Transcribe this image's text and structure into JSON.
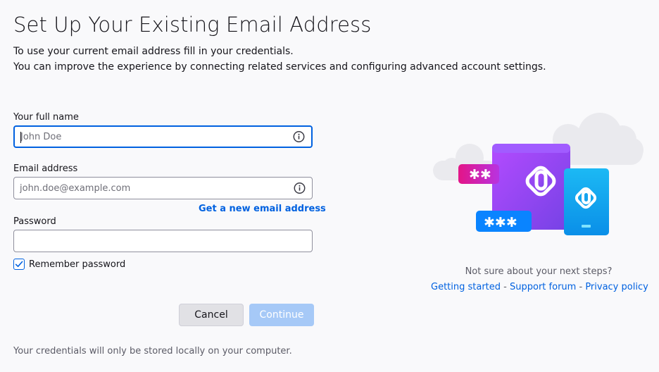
{
  "header": {
    "title": "Set Up Your Existing Email Address",
    "description_line1": "To use your current email address fill in your credentials.",
    "description_line2": "You can improve the experience by connecting related services and configuring advanced account settings."
  },
  "form": {
    "full_name": {
      "label": "Your full name",
      "placeholder": "John Doe",
      "value": ""
    },
    "email": {
      "label": "Email address",
      "placeholder": "john.doe@example.com",
      "value": "",
      "new_address_link": "Get a new email address"
    },
    "password": {
      "label": "Password",
      "value": ""
    },
    "remember_password": {
      "label": "Remember password",
      "checked": true
    },
    "buttons": {
      "cancel": "Cancel",
      "continue": "Continue"
    },
    "footer_note": "Your credentials will only be stored locally on your computer."
  },
  "help": {
    "question": "Not sure about your next steps?",
    "links": {
      "getting_started": "Getting started",
      "support_forum": "Support forum",
      "privacy_policy": "Privacy policy",
      "separator": "-"
    }
  },
  "icons": {
    "field_info": "info-icon",
    "checkbox_mark": "checkmark-icon",
    "illustration": "account-setup-illustration"
  },
  "colors": {
    "accent": "#0061e0",
    "continue_disabled": "#a6c9f7",
    "illustration_purple": "#9059ff",
    "illustration_blue": "#00b3f4",
    "illustration_pink": "#e31587"
  }
}
